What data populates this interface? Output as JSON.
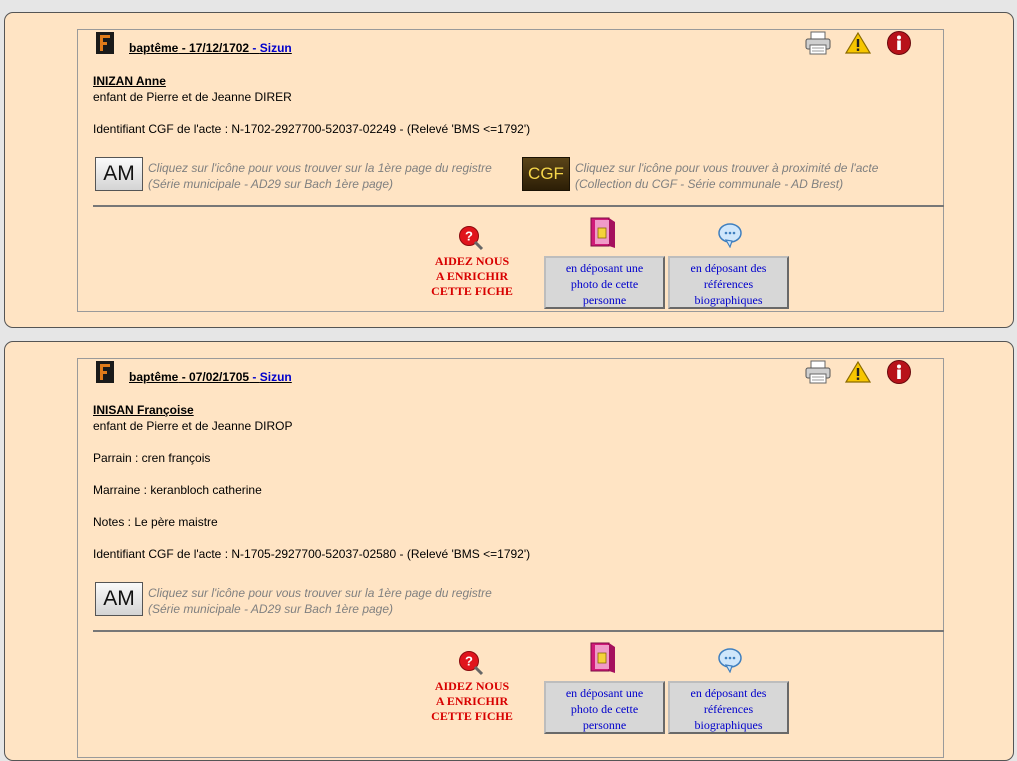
{
  "records": [
    {
      "head_type": "baptême",
      "head_date": "17/12/1702",
      "head_sep": " - ",
      "place": "Sizun",
      "name": "INIZAN Anne",
      "parents": "enfant de Pierre et de Jeanne DIRER",
      "identifier": "Identifiant CGF de l'acte : N-1702-2927700-52037-02249 - (Relevé 'BMS <=1792')",
      "am_label": "AM",
      "am_hint1": "Cliquez sur l'icône pour vous trouver sur la 1ère page du registre",
      "am_hint2": "(Série municipale - AD29 sur Bach 1ère page)",
      "cgf_label": "CGF",
      "cgf_hint1": "Cliquez sur l'icône pour vous trouver à proximité de l'acte",
      "cgf_hint2": "(Collection du CGF - Série communale - AD Brest)"
    },
    {
      "head_type": "baptême",
      "head_date": "07/02/1705",
      "head_sep": " - ",
      "place": "Sizun",
      "name": "INISAN Françoise",
      "parents": "enfant de Pierre et de Jeanne DIROP",
      "parrain": "Parrain : cren françois",
      "marraine": "Marraine : keranbloch catherine",
      "notes": "Notes : Le père maistre",
      "identifier": "Identifiant CGF de l'acte : N-1705-2927700-52037-02580 - (Relevé 'BMS <=1792')",
      "am_label": "AM",
      "am_hint1": "Cliquez sur l'icône pour vous trouver sur la 1ère page du registre",
      "am_hint2": "(Série municipale - AD29 sur Bach 1ère page)"
    }
  ],
  "help": {
    "line1": "AIDEZ NOUS",
    "line2": "A ENRICHIR",
    "line3": "CETTE FICHE"
  },
  "buttons": {
    "photo": [
      "en déposant une",
      "photo de cette",
      "personne"
    ],
    "refs": [
      "en déposant des",
      "références",
      "biographiques"
    ]
  },
  "colors": {
    "card_bg": "#ffe4c4",
    "help_red": "#d80000",
    "link_blue": "#0000cc",
    "hint_gray": "#808080"
  },
  "icons": [
    "favicon-icon",
    "print-icon",
    "warning-icon",
    "info-icon",
    "help-icon",
    "book-icon",
    "bubble-icon"
  ]
}
